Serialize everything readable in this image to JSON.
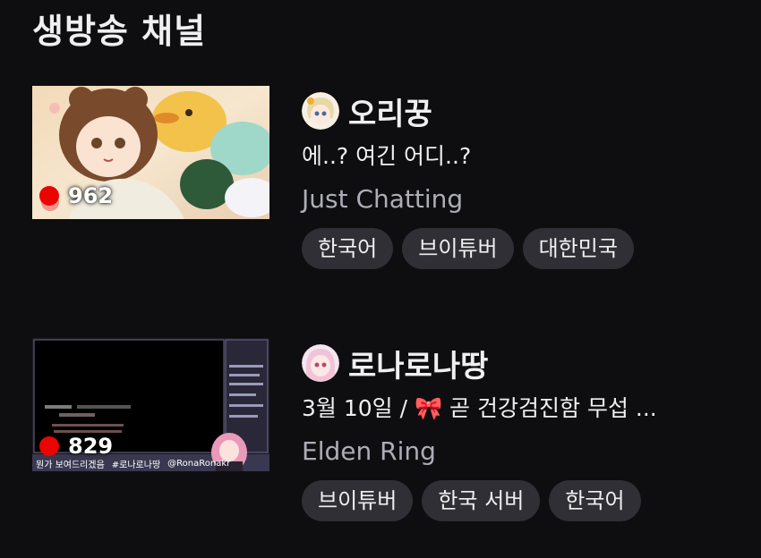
{
  "section": {
    "title": "생방송 채널"
  },
  "colors": {
    "background": "#0e0e10",
    "live_red": "#eb0400",
    "tag_bg": "#2f2f35",
    "muted_text": "#adadb8"
  },
  "streams": [
    {
      "channel_name": "오리꿍",
      "title": "에..? 여긴 어디..?",
      "category": "Just Chatting",
      "viewers": "962",
      "avatar_icon": "anime-girl-avatar-icon",
      "tags": [
        "한국어",
        "브이튜버",
        "대한민국"
      ]
    },
    {
      "channel_name": "로나로나땅",
      "title": "3월 10일 / 🎀 곧 건강검진함 무섭 ...",
      "category": "Elden Ring",
      "viewers": "829",
      "avatar_icon": "anime-girl-avatar-icon",
      "thumbnail_overlay": {
        "banner_left": "뭔가 보여드리겠음",
        "banner_hashtag": "#로나로나땅",
        "banner_handle": "@RonaRonakr"
      },
      "tags": [
        "브이튜버",
        "한국 서버",
        "한국어"
      ]
    }
  ]
}
